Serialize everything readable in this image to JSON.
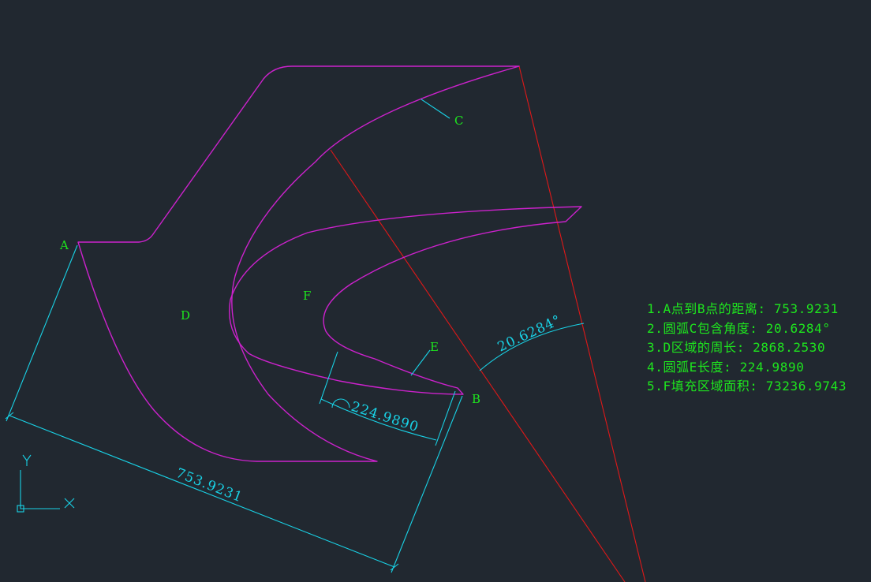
{
  "labels": {
    "a": "A",
    "b": "B",
    "c": "C",
    "d": "D",
    "e": "E",
    "f": "F"
  },
  "dimensions": {
    "ab_distance": "753.9231",
    "arc_e_length": "224.9890",
    "arc_c_angle": "20.6284°"
  },
  "ucs": {
    "x_label": "X",
    "y_label": "Y"
  },
  "notes": [
    "1.A点到B点的距离: 753.9231",
    "2.圆弧C包含角度: 20.6284°",
    "3.D区域的周长: 2868.2530",
    "4.圆弧E长度: 224.9890",
    "5.F填充区域面积: 73236.9743"
  ],
  "colors": {
    "background": "#212830",
    "geometry": "#cc22cc",
    "dimension": "#19d2e6",
    "construction": "#e01818",
    "text": "#1ee61e"
  }
}
